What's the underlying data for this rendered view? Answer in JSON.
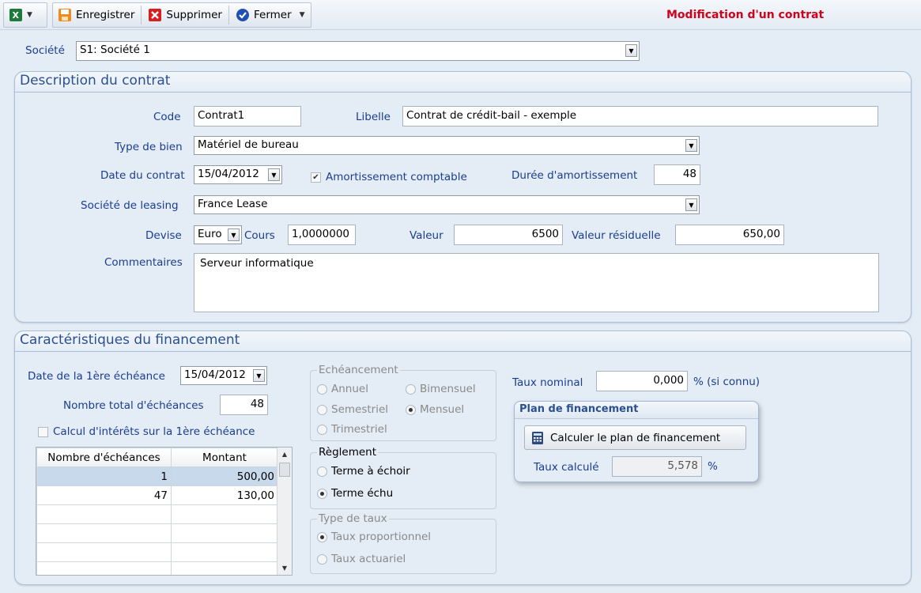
{
  "toolbar": {
    "excel_icon": "excel-icon",
    "save_label": "Enregistrer",
    "delete_label": "Supprimer",
    "close_label": "Fermer",
    "page_title": "Modification d'un contrat"
  },
  "societe": {
    "label": "Société",
    "value": "S1: Société 1"
  },
  "description": {
    "title": "Description du contrat",
    "code_label": "Code",
    "code_value": "Contrat1",
    "libelle_label": "Libelle",
    "libelle_value": "Contrat de crédit-bail - exemple",
    "type_bien_label": "Type de bien",
    "type_bien_value": "Matériel de bureau",
    "date_contrat_label": "Date du contrat",
    "date_contrat_value": "15/04/2012",
    "amort_label": "Amortissement comptable",
    "amort_checked": true,
    "duree_label": "Durée d'amortissement",
    "duree_value": "48",
    "leasing_label": "Société de leasing",
    "leasing_value": "France Lease",
    "devise_label": "Devise",
    "devise_value": "Euro",
    "cours_label": "Cours",
    "cours_value": "1,0000000",
    "valeur_label": "Valeur",
    "valeur_value": "6500",
    "residuelle_label": "Valeur résiduelle",
    "residuelle_value": "650,00",
    "comment_label": "Commentaires",
    "comment_value": "Serveur informatique"
  },
  "financement": {
    "title": "Caractéristiques du financement",
    "date_ech_label": "Date de la 1ère échéance",
    "date_ech_value": "15/04/2012",
    "nb_ech_label": "Nombre total d'échéances",
    "nb_ech_value": "48",
    "calcul_label": "Calcul d'intérêts sur la 1ère échéance",
    "calcul_checked": false,
    "grid": {
      "headers": [
        "Nombre d'échéances",
        "Montant"
      ],
      "rows": [
        {
          "nb": "1",
          "montant": "500,00"
        },
        {
          "nb": "47",
          "montant": "130,00"
        },
        {
          "nb": "",
          "montant": ""
        },
        {
          "nb": "",
          "montant": ""
        },
        {
          "nb": "",
          "montant": ""
        },
        {
          "nb": "",
          "montant": ""
        }
      ]
    },
    "echeancement": {
      "caption": "Echéancement",
      "annuel": "Annuel",
      "bimensuel": "Bimensuel",
      "semestriel": "Semestriel",
      "mensuel": "Mensuel",
      "trimestriel": "Trimestriel",
      "selected": "Mensuel"
    },
    "reglement": {
      "caption": "Règlement",
      "terme_echoir": "Terme à échoir",
      "terme_echu": "Terme échu",
      "selected": "Terme échu"
    },
    "type_taux": {
      "caption": "Type de taux",
      "proportionnel": "Taux proportionnel",
      "actuariel": "Taux actuariel",
      "selected": "Taux proportionnel"
    },
    "taux_nominal_label": "Taux nominal",
    "taux_nominal_value": "0,000",
    "taux_nominal_suffix": "% (si connu)",
    "plan": {
      "title": "Plan de financement",
      "button_label": "Calculer le plan de financement",
      "taux_calcule_label": "Taux calculé",
      "taux_calcule_value": "5,578",
      "percent": "%"
    }
  },
  "colors": {
    "label_blue": "#1a3d8f",
    "panel_bg": "#e4ecf5",
    "title_red": "#d0021b"
  }
}
